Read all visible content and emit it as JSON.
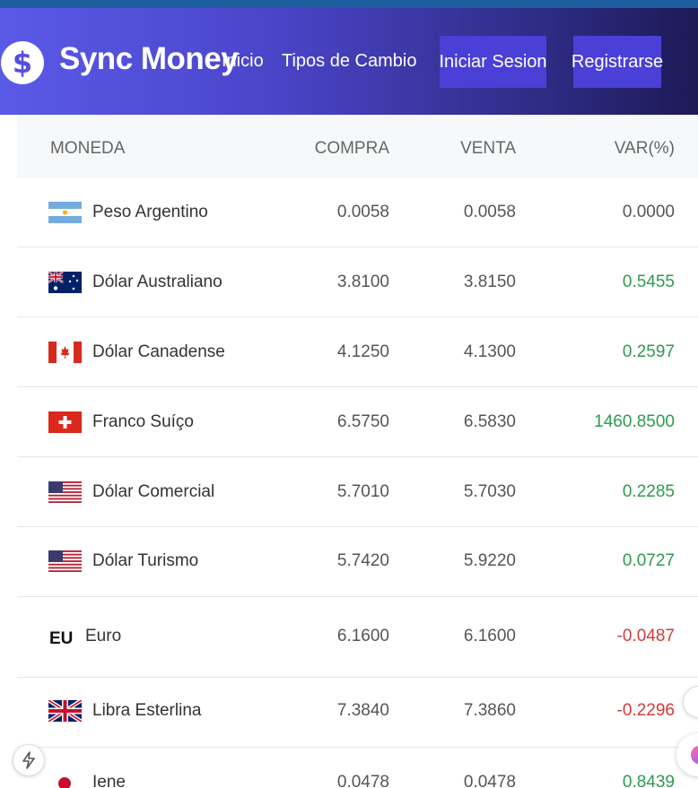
{
  "header": {
    "logo_symbol": "$",
    "brand": "Sync Money",
    "nav": {
      "inicio": "Inicio",
      "tipos": "Tipos de Cambio",
      "login": "Iniciar Sesion",
      "register": "Registrarse"
    }
  },
  "table": {
    "headers": {
      "moneda": "MONEDA",
      "compra": "COMPRA",
      "venta": "VENTA",
      "var": "VAR(%)"
    },
    "rows": [
      {
        "flag": "argentina-flag",
        "name": "Peso Argentino",
        "compra": "0.0058",
        "venta": "0.0058",
        "var": "0.0000",
        "trend": "zero"
      },
      {
        "flag": "australia-flag",
        "name": "Dólar Australiano",
        "compra": "3.8100",
        "venta": "3.8150",
        "var": "0.5455",
        "trend": "pos"
      },
      {
        "flag": "canada-flag",
        "name": "Dólar Canadense",
        "compra": "4.1250",
        "venta": "4.1300",
        "var": "0.2597",
        "trend": "pos"
      },
      {
        "flag": "switzerland-flag",
        "name": "Franco Suíço",
        "compra": "6.5750",
        "venta": "6.5830",
        "var": "1460.8500",
        "trend": "pos"
      },
      {
        "flag": "usa-flag",
        "name": "Dólar Comercial",
        "compra": "5.7010",
        "venta": "5.7030",
        "var": "0.2285",
        "trend": "pos"
      },
      {
        "flag": "usa-flag",
        "name": "Dólar Turismo",
        "compra": "5.7420",
        "venta": "5.9220",
        "var": "0.0727",
        "trend": "pos"
      },
      {
        "flag": "eu-label",
        "flag_text": "EU",
        "name": "Euro",
        "compra": "6.1600",
        "venta": "6.1600",
        "var": "-0.0487",
        "trend": "neg"
      },
      {
        "flag": "uk-flag",
        "name": "Libra Esterlina",
        "compra": "7.3840",
        "venta": "7.3860",
        "var": "-0.2296",
        "trend": "neg"
      },
      {
        "flag": "japan-flag",
        "name": "Iene",
        "compra": "0.0478",
        "venta": "0.0478",
        "var": "0.8439",
        "trend": "pos"
      }
    ]
  },
  "colors": {
    "positive": "#2e9a4d",
    "negative": "#d23a3a",
    "brand": "#5a5ae8",
    "button": "#4a3fd6"
  },
  "floating": {
    "bolt_icon": "lightning-icon"
  }
}
